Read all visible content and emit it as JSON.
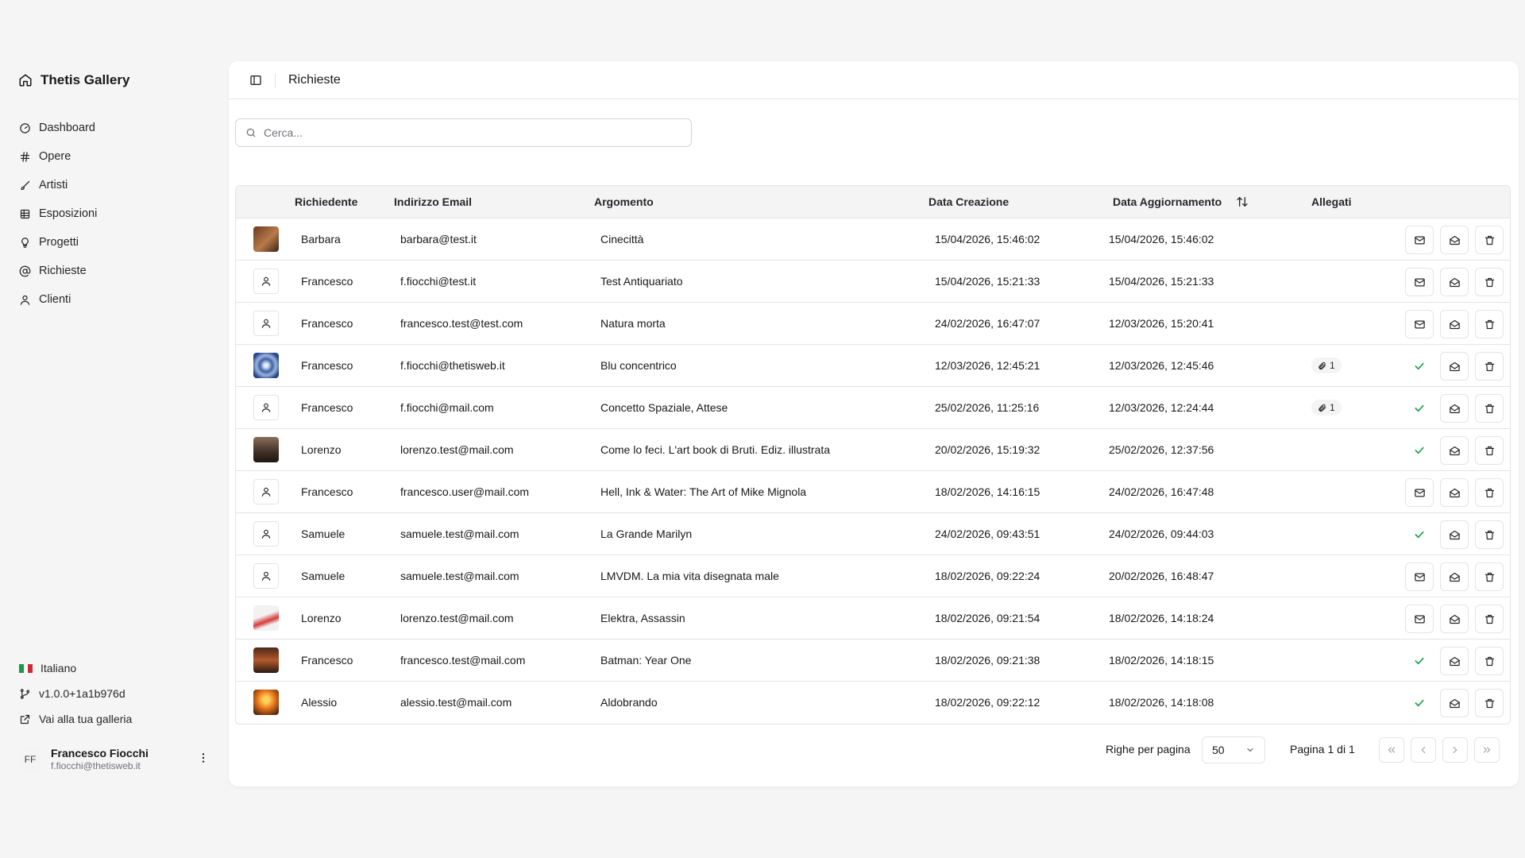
{
  "app": {
    "title": "Thetis Gallery"
  },
  "sidebar": {
    "items": [
      {
        "label": "Dashboard",
        "icon": "gauge-icon"
      },
      {
        "label": "Opere",
        "icon": "hash-icon"
      },
      {
        "label": "Artisti",
        "icon": "brush-icon"
      },
      {
        "label": "Esposizioni",
        "icon": "grid-icon"
      },
      {
        "label": "Progetti",
        "icon": "lightbulb-icon"
      },
      {
        "label": "Richieste",
        "icon": "at-sign-icon"
      },
      {
        "label": "Clienti",
        "icon": "user-icon"
      }
    ],
    "footer": {
      "language": "Italiano",
      "version": "v1.0.0+1a1b976d",
      "gallery_link": "Vai alla tua galleria"
    },
    "user": {
      "initials": "FF",
      "name": "Francesco Fiocchi",
      "email": "f.fiocchi@thetisweb.it"
    }
  },
  "header": {
    "title": "Richieste"
  },
  "search": {
    "placeholder": "Cerca..."
  },
  "table": {
    "headers": {
      "requester": "Richiedente",
      "email": "Indirizzo Email",
      "topic": "Argomento",
      "created": "Data Creazione",
      "updated": "Data Aggiornamento",
      "attachments": "Allegati"
    },
    "rows": [
      {
        "name": "Barbara",
        "email": "barbara@test.it",
        "topic": "Cinecittà",
        "created": "15/04/2026, 15:46:02",
        "updated": "15/04/2026, 15:46:02",
        "attachments": "",
        "read": false
      },
      {
        "name": "Francesco",
        "email": "f.fiocchi@test.it",
        "topic": "Test Antiquariato",
        "created": "15/04/2026, 15:21:33",
        "updated": "15/04/2026, 15:21:33",
        "attachments": "",
        "read": false
      },
      {
        "name": "Francesco",
        "email": "francesco.test@test.com",
        "topic": "Natura morta",
        "created": "24/02/2026, 16:47:07",
        "updated": "12/03/2026, 15:20:41",
        "attachments": "",
        "read": false
      },
      {
        "name": "Francesco",
        "email": "f.fiocchi@thetisweb.it",
        "topic": "Blu concentrico",
        "created": "12/03/2026, 12:45:21",
        "updated": "12/03/2026, 12:45:46",
        "attachments": "1",
        "read": true
      },
      {
        "name": "Francesco",
        "email": "f.fiocchi@mail.com",
        "topic": "Concetto Spaziale, Attese",
        "created": "25/02/2026, 11:25:16",
        "updated": "12/03/2026, 12:24:44",
        "attachments": "1",
        "read": true
      },
      {
        "name": "Lorenzo",
        "email": "lorenzo.test@mail.com",
        "topic": "Come lo feci. L'art book di Bruti. Ediz. illustrata",
        "created": "20/02/2026, 15:19:32",
        "updated": "25/02/2026, 12:37:56",
        "attachments": "",
        "read": true
      },
      {
        "name": "Francesco",
        "email": "francesco.user@mail.com",
        "topic": "Hell, Ink & Water: The Art of Mike Mignola",
        "created": "18/02/2026, 14:16:15",
        "updated": "24/02/2026, 16:47:48",
        "attachments": "",
        "read": false
      },
      {
        "name": "Samuele",
        "email": "samuele.test@mail.com",
        "topic": "La Grande Marilyn",
        "created": "24/02/2026, 09:43:51",
        "updated": "24/02/2026, 09:44:03",
        "attachments": "",
        "read": true
      },
      {
        "name": "Samuele",
        "email": "samuele.test@mail.com",
        "topic": "LMVDM. La mia vita disegnata male",
        "created": "18/02/2026, 09:22:24",
        "updated": "20/02/2026, 16:48:47",
        "attachments": "",
        "read": false
      },
      {
        "name": "Lorenzo",
        "email": "lorenzo.test@mail.com",
        "topic": "Elektra, Assassin",
        "created": "18/02/2026, 09:21:54",
        "updated": "18/02/2026, 14:18:24",
        "attachments": "",
        "read": false
      },
      {
        "name": "Francesco",
        "email": "francesco.test@mail.com",
        "topic": "Batman: Year One",
        "created": "18/02/2026, 09:21:38",
        "updated": "18/02/2026, 14:18:15",
        "attachments": "",
        "read": true
      },
      {
        "name": "Alessio",
        "email": "alessio.test@mail.com",
        "topic": "Aldobrando",
        "created": "18/02/2026, 09:22:12",
        "updated": "18/02/2026, 14:18:08",
        "attachments": "",
        "read": true
      }
    ]
  },
  "pagination": {
    "rows_label": "Righe per pagina",
    "rows_value": "50",
    "page_label": "Pagina 1 di 1"
  },
  "colors": {
    "accent_check": "#16a34a",
    "border": "#e4e4e7",
    "header_bg": "#f4f4f5"
  }
}
